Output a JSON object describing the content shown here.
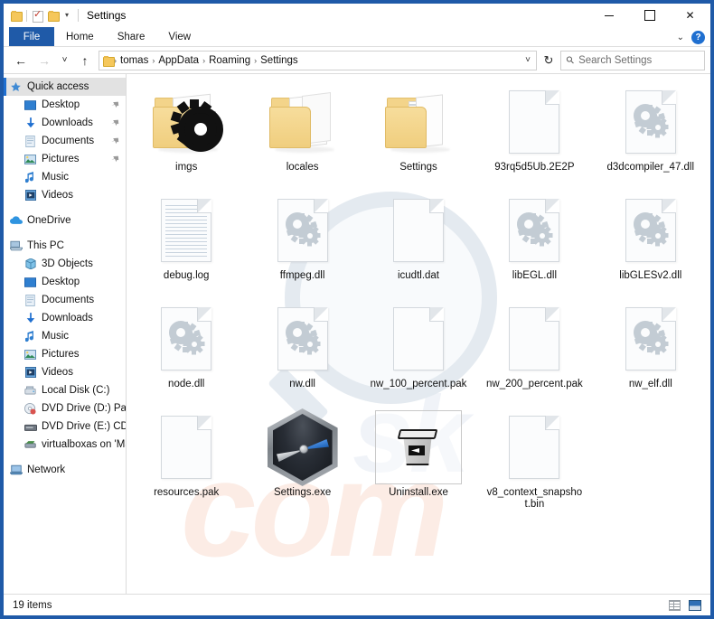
{
  "window": {
    "title": "Settings",
    "quick_access_toolbar": [
      {
        "icon": "folder-icon",
        "name": "explorer-icon"
      },
      {
        "icon": "properties-icon",
        "name": "properties-icon"
      },
      {
        "icon": "new-folder-icon",
        "name": "new-folder-icon"
      },
      {
        "icon": "chevron-down-icon",
        "name": "customize-qat-icon"
      }
    ],
    "controls": {
      "minimize": "–",
      "maximize": "□",
      "close": "✕"
    }
  },
  "ribbon": {
    "tabs": [
      {
        "label": "File",
        "active": true
      },
      {
        "label": "Home",
        "active": false
      },
      {
        "label": "Share",
        "active": false
      },
      {
        "label": "View",
        "active": false
      }
    ],
    "expand_icon": "chevron-down-icon",
    "help_label": "?"
  },
  "navigation": {
    "back_icon": "←",
    "forward_icon": "→",
    "recent_icon": "˅",
    "up_icon": "↑",
    "refresh_icon": "↻",
    "dropdown_icon": "˅",
    "breadcrumbs": [
      "tomas",
      "AppData",
      "Roaming",
      "Settings"
    ],
    "separator": "›"
  },
  "search": {
    "placeholder": "Search Settings",
    "icon": "search-icon"
  },
  "sidebar": {
    "items": [
      {
        "label": "Quick access",
        "icon": "star",
        "indent": 0,
        "selected": true,
        "pinned": false,
        "gap": false
      },
      {
        "label": "Desktop",
        "icon": "desktop",
        "indent": 1,
        "selected": false,
        "pinned": true,
        "gap": false
      },
      {
        "label": "Downloads",
        "icon": "download",
        "indent": 1,
        "selected": false,
        "pinned": true,
        "gap": false
      },
      {
        "label": "Documents",
        "icon": "document",
        "indent": 1,
        "selected": false,
        "pinned": true,
        "gap": false
      },
      {
        "label": "Pictures",
        "icon": "picture",
        "indent": 1,
        "selected": false,
        "pinned": true,
        "gap": false
      },
      {
        "label": "Music",
        "icon": "music",
        "indent": 1,
        "selected": false,
        "pinned": false,
        "gap": false
      },
      {
        "label": "Videos",
        "icon": "video",
        "indent": 1,
        "selected": false,
        "pinned": false,
        "gap": false
      },
      {
        "label": "OneDrive",
        "icon": "cloud",
        "indent": 0,
        "selected": false,
        "pinned": false,
        "gap": true
      },
      {
        "label": "This PC",
        "icon": "pc",
        "indent": 0,
        "selected": false,
        "pinned": false,
        "gap": true
      },
      {
        "label": "3D Objects",
        "icon": "cube",
        "indent": 1,
        "selected": false,
        "pinned": false,
        "gap": false
      },
      {
        "label": "Desktop",
        "icon": "desktop",
        "indent": 1,
        "selected": false,
        "pinned": false,
        "gap": false
      },
      {
        "label": "Documents",
        "icon": "document",
        "indent": 1,
        "selected": false,
        "pinned": false,
        "gap": false
      },
      {
        "label": "Downloads",
        "icon": "download",
        "indent": 1,
        "selected": false,
        "pinned": false,
        "gap": false
      },
      {
        "label": "Music",
        "icon": "music",
        "indent": 1,
        "selected": false,
        "pinned": false,
        "gap": false
      },
      {
        "label": "Pictures",
        "icon": "picture",
        "indent": 1,
        "selected": false,
        "pinned": false,
        "gap": false
      },
      {
        "label": "Videos",
        "icon": "video",
        "indent": 1,
        "selected": false,
        "pinned": false,
        "gap": false
      },
      {
        "label": "Local Disk (C:)",
        "icon": "drive",
        "indent": 1,
        "selected": false,
        "pinned": false,
        "gap": false
      },
      {
        "label": "DVD Drive (D:) Paral",
        "icon": "dvd",
        "indent": 1,
        "selected": false,
        "pinned": false,
        "gap": false
      },
      {
        "label": "DVD Drive (E:) CDRO",
        "icon": "dvd2",
        "indent": 1,
        "selected": false,
        "pinned": false,
        "gap": false
      },
      {
        "label": "virtualboxas on 'Ma",
        "icon": "network-drive",
        "indent": 1,
        "selected": false,
        "pinned": false,
        "gap": false
      },
      {
        "label": "Network",
        "icon": "network",
        "indent": 0,
        "selected": false,
        "pinned": false,
        "gap": true
      }
    ]
  },
  "files": [
    {
      "name": "imgs",
      "type": "folder-gear",
      "selected": false
    },
    {
      "name": "locales",
      "type": "folder-papers",
      "selected": false
    },
    {
      "name": "Settings",
      "type": "folder-striped",
      "selected": false
    },
    {
      "name": "93rq5d5Ub.2E2P",
      "type": "file-blank",
      "selected": false
    },
    {
      "name": "d3dcompiler_47.dll",
      "type": "file-gears",
      "selected": false
    },
    {
      "name": "debug.log",
      "type": "file-lines",
      "selected": false
    },
    {
      "name": "ffmpeg.dll",
      "type": "file-gears",
      "selected": false
    },
    {
      "name": "icudtl.dat",
      "type": "file-blank",
      "selected": false
    },
    {
      "name": "libEGL.dll",
      "type": "file-gears",
      "selected": false
    },
    {
      "name": "libGLESv2.dll",
      "type": "file-gears",
      "selected": false
    },
    {
      "name": "node.dll",
      "type": "file-gears",
      "selected": false
    },
    {
      "name": "nw.dll",
      "type": "file-gears",
      "selected": false
    },
    {
      "name": "nw_100_percent.pak",
      "type": "file-blank",
      "selected": false
    },
    {
      "name": "nw_200_percent.pak",
      "type": "file-blank",
      "selected": false
    },
    {
      "name": "nw_elf.dll",
      "type": "file-gears",
      "selected": false
    },
    {
      "name": "resources.pak",
      "type": "file-blank",
      "selected": false
    },
    {
      "name": "Settings.exe",
      "type": "exe-compass",
      "selected": false
    },
    {
      "name": "Uninstall.exe",
      "type": "exe-trash",
      "selected": true
    },
    {
      "name": "v8_context_snapshot.bin",
      "type": "file-blank",
      "selected": false
    }
  ],
  "statusbar": {
    "item_count": "19 items",
    "view_details_icon": "details-view-icon",
    "view_large_icon": "large-icons-view-icon"
  },
  "colors": {
    "window_border": "#1f5aa8",
    "accent": "#1f6fd0",
    "file_tab": "#1f5aa8",
    "folder_yellow": "#f0ce7e",
    "gear_gray": "#c3ccd4",
    "selection": "#e2e2e2"
  }
}
